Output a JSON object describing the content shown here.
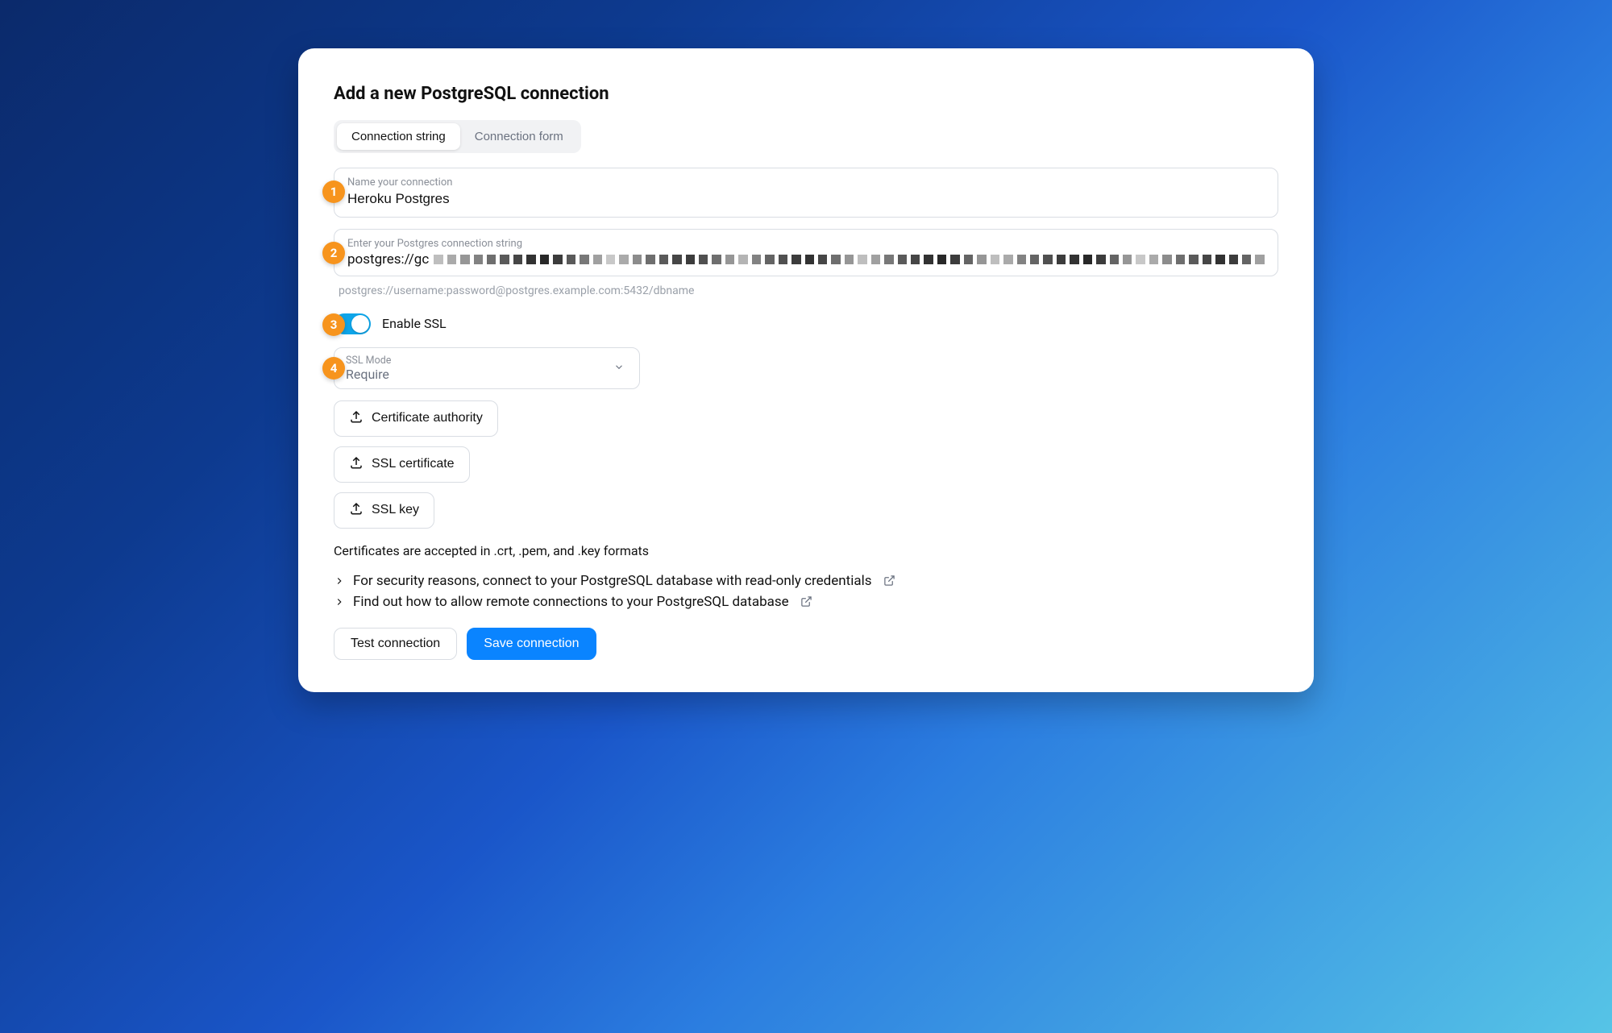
{
  "heading": "Add a new PostgreSQL connection",
  "tabs": {
    "connection_string": "Connection string",
    "connection_form": "Connection form"
  },
  "name_field": {
    "label": "Name your connection",
    "value": "Heroku Postgres"
  },
  "conn_field": {
    "label": "Enter your Postgres connection string",
    "prefix": "postgres://gc"
  },
  "conn_hint": "postgres://username:password@postgres.example.com:5432/dbname",
  "ssl": {
    "toggle_label": "Enable SSL",
    "mode_label": "SSL Mode",
    "mode_value": "Require",
    "ca_button": "Certificate authority",
    "cert_button": "SSL certificate",
    "key_button": "SSL key",
    "cert_note": "Certificates are accepted in .crt, .pem, and .key formats"
  },
  "tips": {
    "readonly": "For security reasons, connect to your PostgreSQL database with read-only credentials",
    "remote": "Find out how to allow remote connections to your PostgreSQL database"
  },
  "actions": {
    "test": "Test connection",
    "save": "Save connection"
  },
  "callouts": [
    "1",
    "2",
    "3",
    "4"
  ],
  "colors": {
    "accent": "#0a84ff",
    "toggle": "#0ea5e9",
    "callout": "#f7941d"
  }
}
